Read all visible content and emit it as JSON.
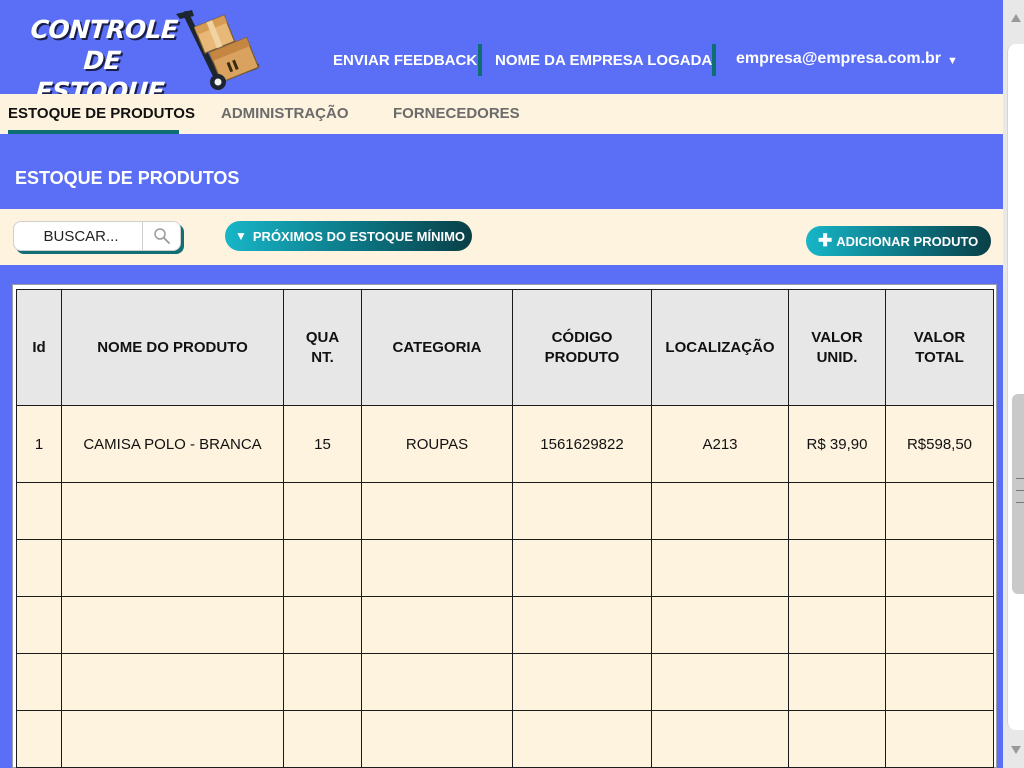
{
  "app": {
    "logo_line1": "CONTROLE DE",
    "logo_line2": "ESTOQUE"
  },
  "header": {
    "feedback_label": "ENVIAR FEEDBACK",
    "company_label": "NOME DA EMPRESA LOGADA",
    "user_email": "empresa@empresa.com.br"
  },
  "tabs": [
    {
      "label": "ESTOQUE DE PRODUTOS",
      "active": true
    },
    {
      "label": "ADMINISTRAÇÃO",
      "active": false
    },
    {
      "label": "FORNECEDORES",
      "active": false
    }
  ],
  "page": {
    "title": "ESTOQUE DE PRODUTOS"
  },
  "toolbar": {
    "search_placeholder": "BUSCAR...",
    "min_stock_label": "PRÓXIMOS DO ESTOQUE MÍNIMO",
    "add_product_label": "ADICIONAR PRODUTO"
  },
  "table": {
    "columns": [
      {
        "line1": "Id",
        "line2": ""
      },
      {
        "line1": "NOME DO PRODUTO",
        "line2": ""
      },
      {
        "line1": "QUA",
        "line2": "NT."
      },
      {
        "line1": "CATEGORIA",
        "line2": ""
      },
      {
        "line1": "CÓDIGO",
        "line2": "PRODUTO"
      },
      {
        "line1": "LOCALIZAÇÃO",
        "line2": ""
      },
      {
        "line1": "VALOR",
        "line2": "UNID."
      },
      {
        "line1": "VALOR",
        "line2": "TOTAL"
      }
    ],
    "rows": [
      [
        "1",
        "CAMISA POLO - BRANCA",
        "15",
        "ROUPAS",
        "1561629822",
        "A213",
        "R$ 39,90",
        "R$598,50"
      ]
    ]
  },
  "colors": {
    "primary_blue": "#5a6ff5",
    "cream": "#fdf3de",
    "teal": "#0d6f73"
  },
  "icons": {
    "logo": "hand-truck-boxes-icon",
    "search": "magnifier-icon",
    "dropdown": "caret-down-icon",
    "filter": "triangle-down-icon",
    "add": "plus-icon"
  }
}
